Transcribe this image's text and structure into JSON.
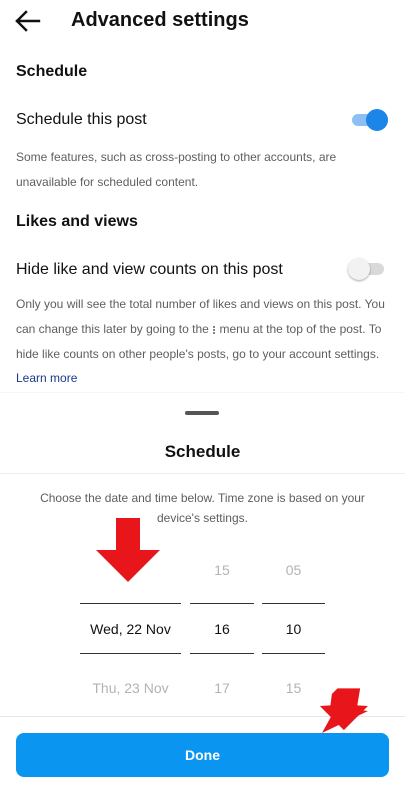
{
  "header": {
    "title": "Advanced settings",
    "back_icon": "back-arrow-icon"
  },
  "schedule_section": {
    "heading": "Schedule",
    "toggle_label": "Schedule this post",
    "toggle_on": true,
    "description": "Some features, such as cross-posting to other accounts, are unavailable for scheduled content."
  },
  "likes_section": {
    "heading": "Likes and views",
    "toggle_label": "Hide like and view counts on this post",
    "toggle_on": false,
    "desc_part1": "Only you will see the total number of likes and views on this post. You can change this later by going to the",
    "menu_icon": "more-vertical-icon",
    "desc_part2": "menu at the top of the post. To hide like counts on other people's posts, go to your account settings.",
    "learn_more": "Learn more"
  },
  "sheet": {
    "title": "Schedule",
    "description": "Choose the date and time below. Time zone is based on your device's settings.",
    "date_column": {
      "above": "",
      "selected": "Wed, 22 Nov",
      "below": "Thu, 23 Nov"
    },
    "hour_column": {
      "above": "15",
      "selected": "16",
      "below": "17"
    },
    "minute_column": {
      "above": "05",
      "selected": "10",
      "below": "15"
    },
    "done_label": "Done"
  },
  "colors": {
    "accent": "#0a96f0",
    "toggle_on": "#1c86e8",
    "annotation_arrow": "#e8151b",
    "link": "#173a8a"
  }
}
